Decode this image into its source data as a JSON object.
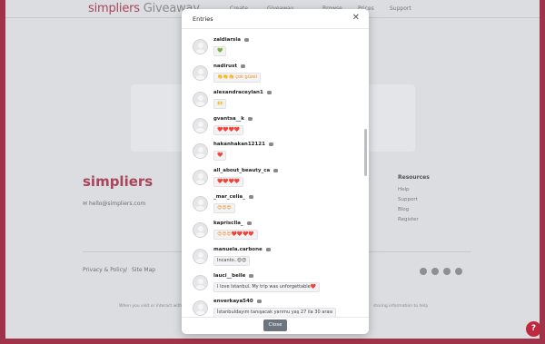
{
  "brand": {
    "name": "simpliers",
    "suffix": " Giveaway"
  },
  "nav": {
    "create": "Create",
    "giveaway": "Giveaway",
    "browse": "Browse",
    "prices": "Prices",
    "support": "Support"
  },
  "footer": {
    "brand": "simpliers",
    "email": "hello@simpliers.com",
    "resources_title": "Resources",
    "resources": [
      "Help",
      "Support",
      "Blog",
      "Register"
    ],
    "privacy": "Privacy & Policy",
    "sitemap": "Site Map",
    "cookie_left": "When you visit or interact with",
    "cookie_right": "storing information to help"
  },
  "modal": {
    "title": "Entries",
    "close_button": "Close",
    "entries": [
      {
        "username": "zaldiarsla",
        "comment": "💚",
        "color": "green"
      },
      {
        "username": "nadirust",
        "comment": "👏👏👏 çok güzel",
        "color": "orange"
      },
      {
        "username": "alexandraceylan1",
        "comment": "🙌",
        "color": "orange"
      },
      {
        "username": "gvantsa__k",
        "comment": "❤️❤️❤️❤️",
        "color": "red"
      },
      {
        "username": "hakanhakan12121",
        "comment": "❤️",
        "color": "red"
      },
      {
        "username": "all_about_beauty_ca",
        "comment": "❤️❤️❤️❤️",
        "color": "red"
      },
      {
        "username": "_mar_celia_",
        "comment": "😍😍😍",
        "color": "orange"
      },
      {
        "username": "kaprisclla_",
        "comment": "😍😍😍❤️❤️❤️❤️",
        "color": "orange"
      },
      {
        "username": "manuela.carbone",
        "comment": "Incanto..😍😍",
        "color": "dark"
      },
      {
        "username": "lauci__belle",
        "comment": "I love Istanbul. My trip was unforgettable❤️",
        "color": "dark"
      },
      {
        "username": "enverkaya540",
        "comment": "İstanbuldayım tanışacak yarımu yaş 27 ila 30 arası",
        "color": "dark"
      }
    ]
  }
}
